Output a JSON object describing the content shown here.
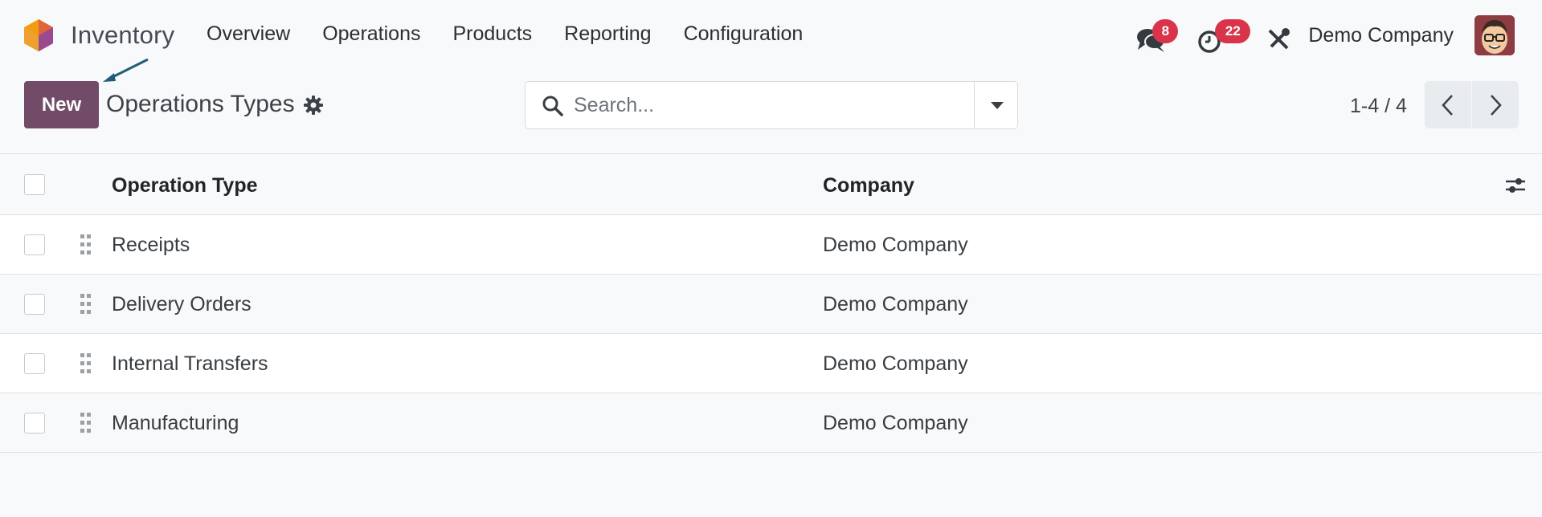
{
  "app": {
    "name": "Inventory",
    "logo_icon": "odoo-inventory-logo",
    "colors": {
      "brand": "#714b67",
      "badge": "#d9344a",
      "arrow": "#1f5d7a"
    }
  },
  "nav": {
    "menu": [
      "Overview",
      "Operations",
      "Products",
      "Reporting",
      "Configuration"
    ]
  },
  "systray": {
    "messages_icon": "chat-icon",
    "messages_count": "8",
    "activities_icon": "clock-icon",
    "activities_count": "22",
    "debug_icon": "tools-icon",
    "company": "Demo Company",
    "avatar_icon": "user-avatar"
  },
  "control_panel": {
    "new_label": "New",
    "title": "Operations Types",
    "settings_icon": "gear-icon",
    "search_placeholder": "Search...",
    "pager_value": "1-4 / 4"
  },
  "list": {
    "columns": [
      "Operation Type",
      "Company"
    ],
    "rows": [
      {
        "operation_type": "Receipts",
        "company": "Demo Company"
      },
      {
        "operation_type": "Delivery Orders",
        "company": "Demo Company"
      },
      {
        "operation_type": "Internal Transfers",
        "company": "Demo Company"
      },
      {
        "operation_type": "Manufacturing",
        "company": "Demo Company"
      }
    ]
  }
}
